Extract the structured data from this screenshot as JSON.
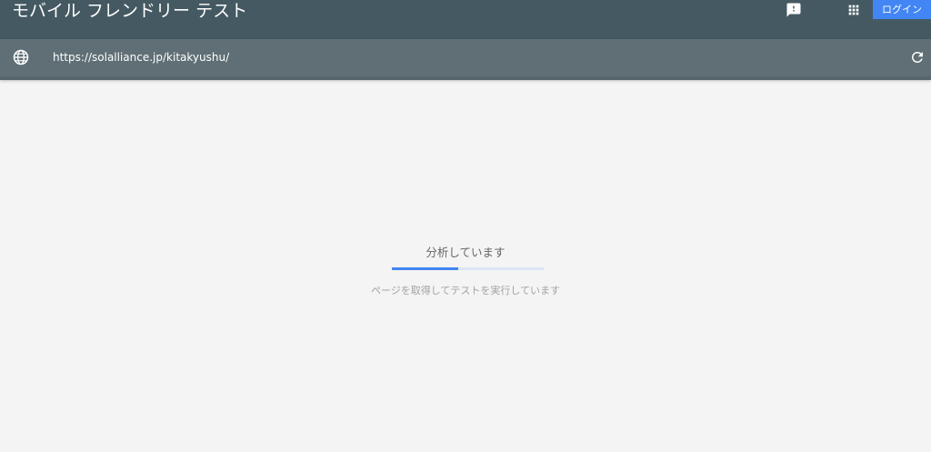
{
  "header": {
    "title": "モバイル フレンドリー テスト",
    "feedback_icon": "feedback-icon",
    "apps_icon": "apps-grid-icon",
    "login_label": "ログイン"
  },
  "urlbar": {
    "globe_icon": "globe-icon",
    "url_value": "https://solalliance.jp/kitakyushu/",
    "reload_icon": "reload-icon"
  },
  "status": {
    "title": "分析しています",
    "progress_percent": 44,
    "subtitle": "ページを取得してテストを実行しています"
  },
  "colors": {
    "topbar": "#445962",
    "urlbar": "#5f6f75",
    "accent": "#4285f4",
    "progress_track": "#dde6f4",
    "background": "#f4f4f4"
  }
}
